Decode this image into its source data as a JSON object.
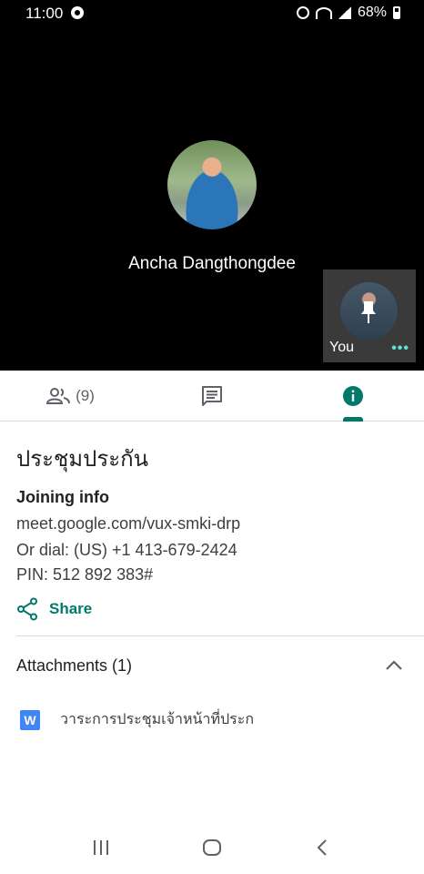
{
  "status_bar": {
    "time": "11:00",
    "battery": "68%"
  },
  "call": {
    "participant_name": "Ancha Dangthongdee",
    "self_label": "You",
    "self_more": "•••"
  },
  "tabs": {
    "people_count": "(9)",
    "active": "info"
  },
  "info": {
    "meeting_title": "ประชุมประกัน",
    "joining_heading": "Joining info",
    "link": "meet.google.com/vux-smki-drp",
    "dial": "Or dial: (US) +1 413-679-2424",
    "pin": "PIN: 512 892 383#",
    "share_label": "Share",
    "attachments_heading": "Attachments (1)",
    "attachments": [
      {
        "icon_letter": "W",
        "name": "วาระการประชุมเจ้าหน้าที่ประก"
      }
    ]
  },
  "colors": {
    "accent": "#00796b",
    "video_bg": "#000000",
    "word_blue": "#4285f4"
  }
}
